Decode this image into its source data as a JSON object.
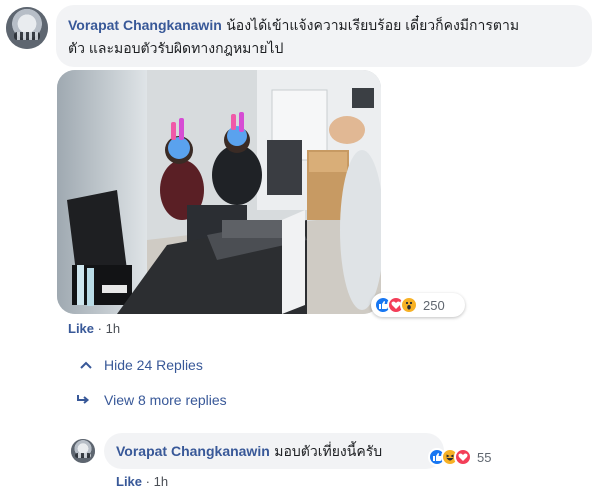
{
  "comment": {
    "author": "Vorapat Changkanawin",
    "text_line1": "น้องได้เข้าแจ้งความเรียบร้อย เดี๋ยวก็คงมีการตาม",
    "text_line2": "ตัว และมอบตัวรับผิดทางกฎหมายไป",
    "reaction_count": "250",
    "like_label": "Like",
    "separator": "·",
    "time": "1h",
    "reactions": [
      "like-icon",
      "love-icon",
      "wow-icon"
    ]
  },
  "thread": {
    "hide_replies_label": "Hide 24 Replies",
    "view_more_label": "View 8 more replies"
  },
  "reply": {
    "author": "Vorapat Changkanawin",
    "text": "มอบตัวเที่ยงนี้ครับ",
    "reaction_count": "55",
    "like_label": "Like",
    "separator": "·",
    "time": "1h",
    "reactions": [
      "like-icon",
      "haha-icon",
      "love-icon"
    ]
  },
  "colors": {
    "link": "#385898",
    "bubble": "#f2f3f5",
    "like": "#1877f2",
    "love": "#f33e58",
    "wow": "#f7b125"
  }
}
